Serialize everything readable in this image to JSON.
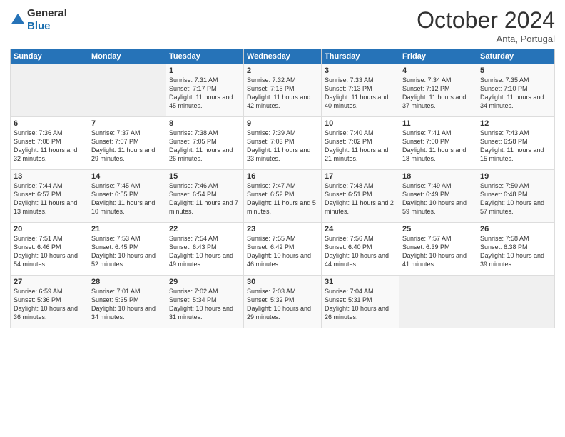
{
  "logo": {
    "general": "General",
    "blue": "Blue"
  },
  "header": {
    "month": "October 2024",
    "location": "Anta, Portugal"
  },
  "weekdays": [
    "Sunday",
    "Monday",
    "Tuesday",
    "Wednesday",
    "Thursday",
    "Friday",
    "Saturday"
  ],
  "weeks": [
    [
      {
        "day": "",
        "info": ""
      },
      {
        "day": "",
        "info": ""
      },
      {
        "day": "1",
        "info": "Sunrise: 7:31 AM\nSunset: 7:17 PM\nDaylight: 11 hours and 45 minutes."
      },
      {
        "day": "2",
        "info": "Sunrise: 7:32 AM\nSunset: 7:15 PM\nDaylight: 11 hours and 42 minutes."
      },
      {
        "day": "3",
        "info": "Sunrise: 7:33 AM\nSunset: 7:13 PM\nDaylight: 11 hours and 40 minutes."
      },
      {
        "day": "4",
        "info": "Sunrise: 7:34 AM\nSunset: 7:12 PM\nDaylight: 11 hours and 37 minutes."
      },
      {
        "day": "5",
        "info": "Sunrise: 7:35 AM\nSunset: 7:10 PM\nDaylight: 11 hours and 34 minutes."
      }
    ],
    [
      {
        "day": "6",
        "info": "Sunrise: 7:36 AM\nSunset: 7:08 PM\nDaylight: 11 hours and 32 minutes."
      },
      {
        "day": "7",
        "info": "Sunrise: 7:37 AM\nSunset: 7:07 PM\nDaylight: 11 hours and 29 minutes."
      },
      {
        "day": "8",
        "info": "Sunrise: 7:38 AM\nSunset: 7:05 PM\nDaylight: 11 hours and 26 minutes."
      },
      {
        "day": "9",
        "info": "Sunrise: 7:39 AM\nSunset: 7:03 PM\nDaylight: 11 hours and 23 minutes."
      },
      {
        "day": "10",
        "info": "Sunrise: 7:40 AM\nSunset: 7:02 PM\nDaylight: 11 hours and 21 minutes."
      },
      {
        "day": "11",
        "info": "Sunrise: 7:41 AM\nSunset: 7:00 PM\nDaylight: 11 hours and 18 minutes."
      },
      {
        "day": "12",
        "info": "Sunrise: 7:43 AM\nSunset: 6:58 PM\nDaylight: 11 hours and 15 minutes."
      }
    ],
    [
      {
        "day": "13",
        "info": "Sunrise: 7:44 AM\nSunset: 6:57 PM\nDaylight: 11 hours and 13 minutes."
      },
      {
        "day": "14",
        "info": "Sunrise: 7:45 AM\nSunset: 6:55 PM\nDaylight: 11 hours and 10 minutes."
      },
      {
        "day": "15",
        "info": "Sunrise: 7:46 AM\nSunset: 6:54 PM\nDaylight: 11 hours and 7 minutes."
      },
      {
        "day": "16",
        "info": "Sunrise: 7:47 AM\nSunset: 6:52 PM\nDaylight: 11 hours and 5 minutes."
      },
      {
        "day": "17",
        "info": "Sunrise: 7:48 AM\nSunset: 6:51 PM\nDaylight: 11 hours and 2 minutes."
      },
      {
        "day": "18",
        "info": "Sunrise: 7:49 AM\nSunset: 6:49 PM\nDaylight: 10 hours and 59 minutes."
      },
      {
        "day": "19",
        "info": "Sunrise: 7:50 AM\nSunset: 6:48 PM\nDaylight: 10 hours and 57 minutes."
      }
    ],
    [
      {
        "day": "20",
        "info": "Sunrise: 7:51 AM\nSunset: 6:46 PM\nDaylight: 10 hours and 54 minutes."
      },
      {
        "day": "21",
        "info": "Sunrise: 7:53 AM\nSunset: 6:45 PM\nDaylight: 10 hours and 52 minutes."
      },
      {
        "day": "22",
        "info": "Sunrise: 7:54 AM\nSunset: 6:43 PM\nDaylight: 10 hours and 49 minutes."
      },
      {
        "day": "23",
        "info": "Sunrise: 7:55 AM\nSunset: 6:42 PM\nDaylight: 10 hours and 46 minutes."
      },
      {
        "day": "24",
        "info": "Sunrise: 7:56 AM\nSunset: 6:40 PM\nDaylight: 10 hours and 44 minutes."
      },
      {
        "day": "25",
        "info": "Sunrise: 7:57 AM\nSunset: 6:39 PM\nDaylight: 10 hours and 41 minutes."
      },
      {
        "day": "26",
        "info": "Sunrise: 7:58 AM\nSunset: 6:38 PM\nDaylight: 10 hours and 39 minutes."
      }
    ],
    [
      {
        "day": "27",
        "info": "Sunrise: 6:59 AM\nSunset: 5:36 PM\nDaylight: 10 hours and 36 minutes."
      },
      {
        "day": "28",
        "info": "Sunrise: 7:01 AM\nSunset: 5:35 PM\nDaylight: 10 hours and 34 minutes."
      },
      {
        "day": "29",
        "info": "Sunrise: 7:02 AM\nSunset: 5:34 PM\nDaylight: 10 hours and 31 minutes."
      },
      {
        "day": "30",
        "info": "Sunrise: 7:03 AM\nSunset: 5:32 PM\nDaylight: 10 hours and 29 minutes."
      },
      {
        "day": "31",
        "info": "Sunrise: 7:04 AM\nSunset: 5:31 PM\nDaylight: 10 hours and 26 minutes."
      },
      {
        "day": "",
        "info": ""
      },
      {
        "day": "",
        "info": ""
      }
    ]
  ]
}
